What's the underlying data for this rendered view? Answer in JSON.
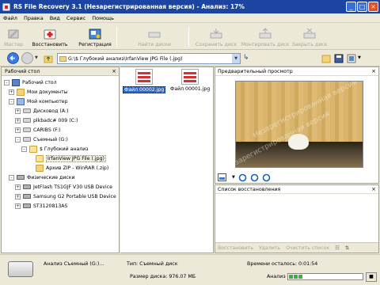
{
  "window": {
    "title": "RS File Recovery 3.1 (Незарегистрированная версия) - Анализ: 17%",
    "controls": [
      "_",
      "□",
      "×"
    ]
  },
  "menu": [
    "Файл",
    "Правка",
    "Вид",
    "Сервис",
    "Помощь"
  ],
  "toolbar": {
    "wizard": "Мастер",
    "restore": "Восстановить",
    "register": "Регистрация",
    "find_disks": "Найти диски",
    "save_disk": "Сохранить диск",
    "mount_disk": "Монтировать диск",
    "close_disk": "Закрыть диск"
  },
  "address": {
    "path": "G:\\$ Глубокий анализ\\IrfanView JPG File (.jpg)"
  },
  "tree": {
    "header": "Рабочий стол",
    "items": [
      {
        "label": "Рабочий стол",
        "expander": "-",
        "icon": "desktop"
      },
      {
        "label": "Мои документы",
        "expander": "+",
        "icon": "folder"
      },
      {
        "label": "Мой компьютер",
        "expander": "-",
        "icon": "computer"
      },
      {
        "label": "Дисковод (A:)",
        "expander": "+",
        "icon": "drive"
      },
      {
        "label": "plkbadc# 009 (C:)",
        "expander": "+",
        "icon": "drive"
      },
      {
        "label": "CARIBS (F:)",
        "expander": "+",
        "icon": "drive"
      },
      {
        "label": "Съемный (G:)",
        "expander": "-",
        "icon": "drive"
      },
      {
        "label": "$ Глубокий анализ",
        "expander": "-",
        "icon": "folder-open"
      },
      {
        "label": "IrfanView JPG File (.jpg)",
        "expander": "",
        "icon": "folder-open"
      },
      {
        "label": "Архив ZIP - WinRAR (.zip)",
        "expander": "",
        "icon": "folder"
      },
      {
        "label": "Физические диски",
        "expander": "-",
        "icon": "folder"
      },
      {
        "label": "JetFlash TS1GJF V30 USB Device",
        "expander": "+",
        "icon": "physical"
      },
      {
        "label": "Samsung G2 Portable USB Device",
        "expander": "+",
        "icon": "physical"
      },
      {
        "label": "ST3120813AS",
        "expander": "+",
        "icon": "physical"
      }
    ]
  },
  "files": [
    {
      "name": "Файл 00002.jpg",
      "selected": true
    },
    {
      "name": "Файл 00001.jpg",
      "selected": false
    }
  ],
  "preview": {
    "title": "Предварительный просмотр",
    "watermark": "Незарегистрированная версия"
  },
  "recovery": {
    "title": "Список восстановления",
    "restore": "Восстановить",
    "delete": "Удалить",
    "clear": "Очистить список"
  },
  "status": {
    "analysis_label": "Анализ Съемный (G:)...",
    "type": "Тип: Съемный диск",
    "size": "Размер диска: 976.07 МБ",
    "time_left": "Времени осталось: 0:01:54",
    "analysis": "Анализ",
    "progress_percent": 17
  },
  "colors": {
    "titlebar": "#1b45a0",
    "progress": "#2fb83a",
    "selection": "#316ac5"
  }
}
